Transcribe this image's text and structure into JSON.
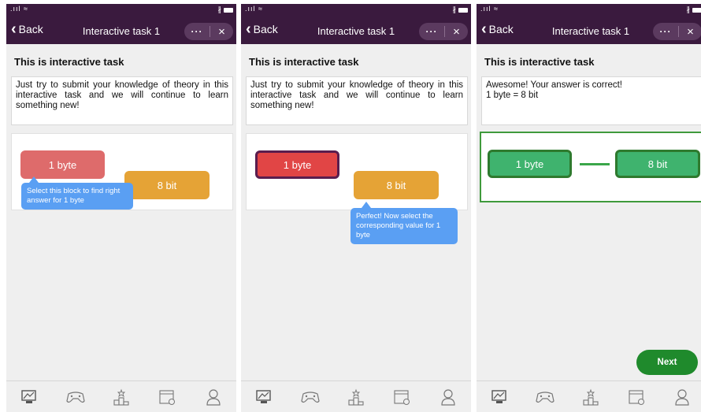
{
  "status_bar": {
    "signal": ".ııl ≈",
    "bluetooth": "∦"
  },
  "screens": [
    {
      "header": {
        "back_label": "Back",
        "title": "Interactive task 1",
        "more": "···",
        "close": "×"
      },
      "heading": "This is interactive task",
      "body_text": "Just try to submit your knowledge of theory in this interactive task and we will continue to learn something new!",
      "blocks": {
        "left": "1 byte",
        "right": "8 bit"
      },
      "tooltip": "Select this block to find right answer for 1 byte"
    },
    {
      "header": {
        "back_label": "Back",
        "title": "Interactive task 1",
        "more": "···",
        "close": "×"
      },
      "heading": "This is interactive task",
      "body_text": "Just try to submit your knowledge of theory in this interactive task and we will continue to learn something new!",
      "blocks": {
        "left": "1 byte",
        "right": "8 bit"
      },
      "tooltip": "Perfect! Now select the corresponding value for 1 byte"
    },
    {
      "header": {
        "back_label": "Back",
        "title": "Interactive task 1",
        "more": "···",
        "close": "×"
      },
      "heading": "This is interactive task",
      "body_line1": "Awesome! Your answer is correct!",
      "body_line2": "1 byte = 8 bit",
      "blocks": {
        "left": "1 byte",
        "right": "8 bit"
      },
      "next_label": "Next"
    }
  ],
  "tabbar": {
    "icons": [
      "monitor-icon",
      "gamepad-icon",
      "podium-icon",
      "calendar-icon",
      "profile-icon"
    ]
  },
  "colors": {
    "header_bg": "#3a1a3e",
    "block_red": "#de6b6b",
    "block_orange": "#e5a336",
    "block_green": "#3fb36e",
    "tooltip_blue": "#5a9ff3",
    "success_green": "#1f8a2c"
  }
}
